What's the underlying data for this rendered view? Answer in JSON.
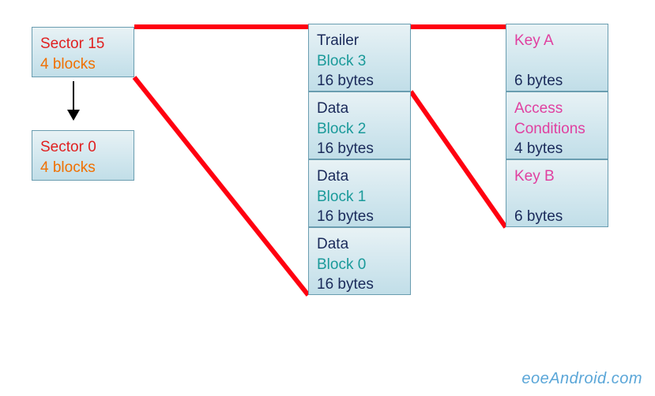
{
  "sectors": {
    "top": {
      "title": "Sector 15",
      "sub": "4 blocks"
    },
    "bottom": {
      "title": "Sector 0",
      "sub": "4 blocks"
    }
  },
  "blocks": {
    "b3": {
      "role": "Trailer",
      "name": "Block 3",
      "size": "16 bytes"
    },
    "b2": {
      "role": "Data",
      "name": "Block 2",
      "size": "16 bytes"
    },
    "b1": {
      "role": "Data",
      "name": "Block 1",
      "size": "16 bytes"
    },
    "b0": {
      "role": "Data",
      "name": "Block 0",
      "size": "16 bytes"
    }
  },
  "trailer": {
    "keyA": {
      "label": "Key A",
      "size": "6 bytes"
    },
    "access": {
      "l1": "Access",
      "l2": "Conditions",
      "size": "4 bytes"
    },
    "keyB": {
      "label": "Key B",
      "size": "6 bytes"
    }
  },
  "watermark": "eoeAndroid.com"
}
